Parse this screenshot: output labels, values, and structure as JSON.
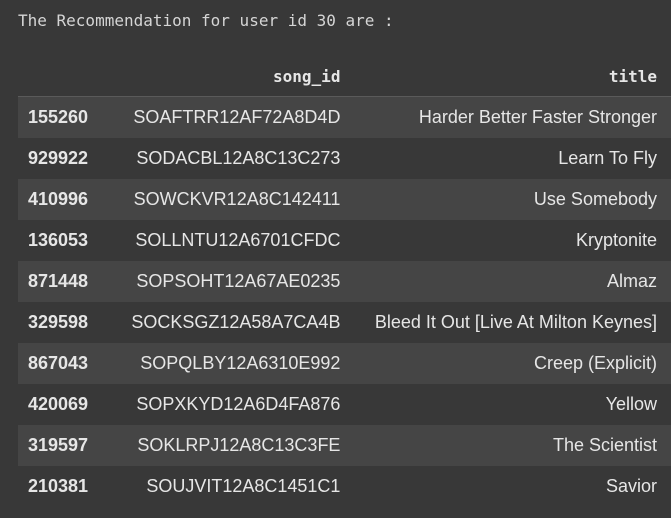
{
  "output": {
    "message": "The Recommendation for user id 30 are :"
  },
  "table": {
    "columns": [
      "",
      "song_id",
      "title"
    ],
    "rows": [
      {
        "index": "155260",
        "song_id": "SOAFTRR12AF72A8D4D",
        "title": "Harder Better Faster Stronger"
      },
      {
        "index": "929922",
        "song_id": "SODACBL12A8C13C273",
        "title": "Learn To Fly"
      },
      {
        "index": "410996",
        "song_id": "SOWCKVR12A8C142411",
        "title": "Use Somebody"
      },
      {
        "index": "136053",
        "song_id": "SOLLNTU12A6701CFDC",
        "title": "Kryptonite"
      },
      {
        "index": "871448",
        "song_id": "SOPSOHT12A67AE0235",
        "title": "Almaz"
      },
      {
        "index": "329598",
        "song_id": "SOCKSGZ12A58A7CA4B",
        "title": "Bleed It Out [Live At Milton Keynes]"
      },
      {
        "index": "867043",
        "song_id": "SOPQLBY12A6310E992",
        "title": "Creep (Explicit)"
      },
      {
        "index": "420069",
        "song_id": "SOPXKYD12A6D4FA876",
        "title": "Yellow"
      },
      {
        "index": "319597",
        "song_id": "SOKLRPJ12A8C13C3FE",
        "title": "The Scientist"
      },
      {
        "index": "210381",
        "song_id": "SOUJVIT12A8C1451C1",
        "title": "Savior"
      }
    ]
  },
  "colors": {
    "background": "#383838",
    "row_stripe": "#454545",
    "text": "#e6e6e6"
  }
}
